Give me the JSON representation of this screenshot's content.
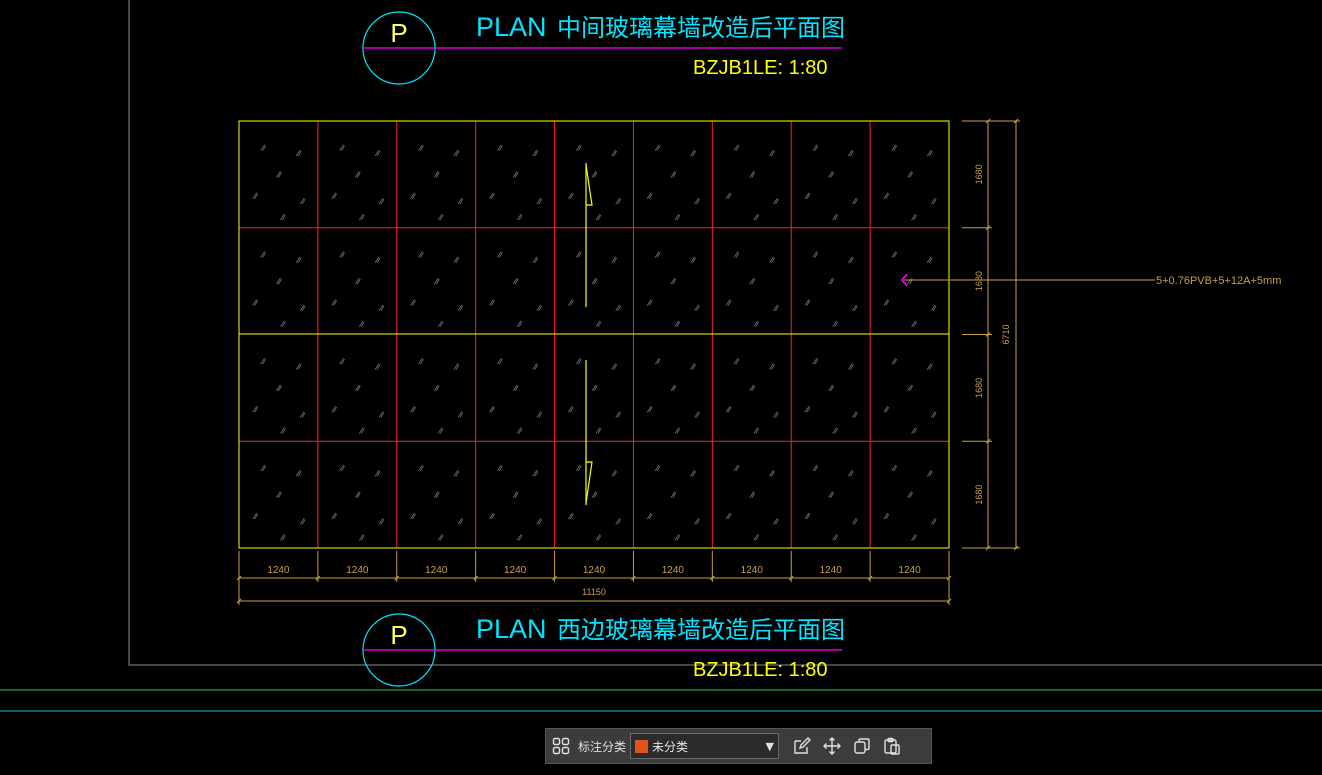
{
  "drawing": {
    "top_title": {
      "prefix": "PLAN",
      "name": "中间玻璃幕墙改造后平面图",
      "scale": "BZJB1LE: 1:80",
      "symbol": "P"
    },
    "bottom_title": {
      "prefix": "PLAN",
      "name": "西边玻璃幕墙改造后平面图",
      "scale": "BZJB1LE: 1:80",
      "symbol": "P"
    },
    "column_widths": [
      "1240",
      "1240",
      "1240",
      "1240",
      "1240",
      "1240",
      "1240",
      "1240",
      "1240"
    ],
    "total_width": "11150",
    "row_heights": [
      "1680",
      "1680",
      "1680",
      "1680"
    ],
    "total_height": "6710",
    "annotation": "5+0.76PVB+5+12A+5mm",
    "colors": {
      "title": "#00e5ff",
      "scale": "#ffff00",
      "grid": "#ff2020",
      "frame": "#ffff00",
      "dim": "#c8a040",
      "circle": "#00e5ff",
      "underline": "#ff00ff",
      "leader_arrow": "#ff00ff"
    }
  },
  "toolbar": {
    "grid_icon": "grid-icon",
    "label": "标注分类",
    "select_value": "未分类",
    "swatch_color": "#e0531d",
    "icons": [
      "edit-icon",
      "move-icon",
      "copy-icon",
      "paste-icon"
    ]
  }
}
